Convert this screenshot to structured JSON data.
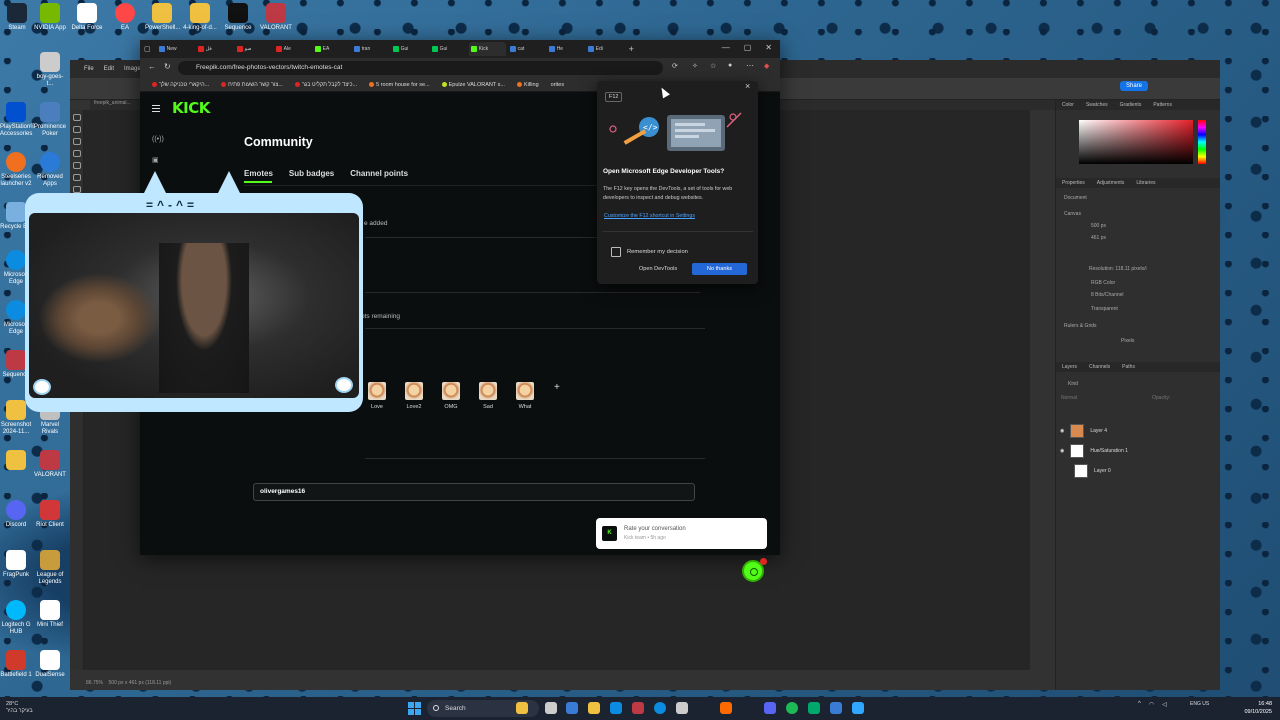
{
  "desktop": {
    "top_icons": [
      {
        "label": "Steam",
        "color": "#1b2838"
      },
      {
        "label": "NVIDIA App",
        "color": "#76b900"
      },
      {
        "label": "Delta Force",
        "color": "#ffffff"
      },
      {
        "label": "EA",
        "color": "#ff4747"
      },
      {
        "label": "PowerShell...",
        "color": "#f0c040"
      },
      {
        "label": "4-king-of-d...",
        "color": "#f0c040"
      },
      {
        "label": "Sequence",
        "color": "#111111"
      },
      {
        "label": "VALORANT",
        "color": "#bd3944"
      }
    ],
    "left_icons": [
      {
        "label": "boy-goes-t...",
        "color": "#cccccc"
      },
      {
        "label": "PlayStation® Accessories",
        "color": "#0050d0"
      },
      {
        "label": "Prominence Poker",
        "color": "#4a7ebc"
      },
      {
        "label": "Steelseries launcher v2",
        "color": "#f07020"
      },
      {
        "label": "Removed Apps",
        "color": "#2a7ad8"
      },
      {
        "label": "Recycle Bin",
        "color": "#7ab0e0"
      },
      {
        "label": "Microsoft Edge",
        "color": "#0c8ce0"
      },
      {
        "label": "Microsoft Edge",
        "color": "#0c8ce0"
      },
      {
        "label": "Sequence",
        "color": "#bd3944"
      },
      {
        "label": "Screenshot 2024-11...",
        "color": "#f0c040"
      },
      {
        "label": "Marvel Rivals",
        "color": "#c0c0c0"
      },
      {
        "label": "",
        "color": "#f0c040"
      },
      {
        "label": "VALORANT",
        "color": "#bd3944"
      },
      {
        "label": "Discord",
        "color": "#5865f2"
      },
      {
        "label": "Riot Client",
        "color": "#d13639"
      },
      {
        "label": "FragPunk",
        "color": "#ffffff"
      },
      {
        "label": "League of Legends",
        "color": "#c89b3c"
      },
      {
        "label": "Logitech G HUB",
        "color": "#00b8fc"
      },
      {
        "label": "Mini Thief",
        "color": "#ffffff"
      },
      {
        "label": "Battlefield 1",
        "color": "#d03a2a"
      },
      {
        "label": "DualSense",
        "color": "#ffffff"
      }
    ]
  },
  "photoshop": {
    "menu": [
      "File",
      "Edit",
      "Image"
    ],
    "share_label": "Share",
    "doc_tab": "freepik_animal...",
    "status_zoom": "86.75%",
    "status_info": "500 px x 461 px (118.11 ppi)",
    "panels": {
      "color_tabs": [
        "Color",
        "Swatches",
        "Gradients",
        "Patterns"
      ],
      "props_tabs": [
        "Properties",
        "Adjustments",
        "Libraries"
      ],
      "document_label": "Document",
      "canvas_label": "Canvas",
      "width": "500 px",
      "height": "461 px",
      "resolution": "Resolution: 118.11 pixels/i",
      "mode": "RGB Color",
      "bits": "8 Bits/Channel",
      "fill": "Transparent",
      "rulers_label": "Rulers & Grids",
      "units": "Pixels",
      "layers_tabs": [
        "Layers",
        "Channels",
        "Paths"
      ],
      "kind_label": "Kind",
      "blend_mode": "Normal",
      "opacity_label": "Opacity:",
      "layers": [
        "Layer 4",
        "Hue/Saturation 1",
        "Layer 0"
      ]
    }
  },
  "browser": {
    "tabs": [
      {
        "label": "New",
        "color": "#3a7bd5",
        "active": false
      },
      {
        "label": "فل",
        "color": "#e02424",
        "active": false
      },
      {
        "label": "صو",
        "color": "#e02424",
        "active": false
      },
      {
        "label": "Ale",
        "color": "#e02424",
        "active": false
      },
      {
        "label": "EA",
        "color": "#53fc18",
        "active": false
      },
      {
        "label": "tran",
        "color": "#3a7bd5",
        "active": false
      },
      {
        "label": "Gui",
        "color": "#00c853",
        "active": false
      },
      {
        "label": "Gui",
        "color": "#00c853",
        "active": false
      },
      {
        "label": "Kick",
        "color": "#53fc18",
        "active": true
      },
      {
        "label": "cat",
        "color": "#3a7bd5",
        "active": false
      },
      {
        "label": "He",
        "color": "#3a7bd5",
        "active": false
      },
      {
        "label": "Edi",
        "color": "#3a7bd5",
        "active": false
      }
    ],
    "url": "Freepik.com/free-photos-vectors/twitch-emotes-cat",
    "bookmarks": [
      {
        "label": "היקארי טכניקה שלך...",
        "color": "#e02424"
      },
      {
        "label": "צור קשר השעות פתיח...",
        "color": "#e02424"
      },
      {
        "label": "כיצד לקבל תקליט בגר...",
        "color": "#e02424"
      },
      {
        "label": "5 room house for se...",
        "color": "#f07020"
      },
      {
        "label": "Epulze VALORANT s...",
        "color": "#c0e020"
      },
      {
        "label": "Killing",
        "color": "#f07020"
      },
      {
        "label": "orites",
        "color": "#cccccc"
      }
    ],
    "kick_logo": "KICK",
    "page_title": "Community",
    "subtabs": [
      "Emotes",
      "Sub badges",
      "Channel points"
    ],
    "info_added": "e added",
    "info_slots": "ots remaining",
    "emotes": [
      {
        "name": "Love"
      },
      {
        "name": "Love2"
      },
      {
        "name": "OMG"
      },
      {
        "name": "Sad"
      },
      {
        "name": "What"
      }
    ],
    "add_emote": "+",
    "username_value": "olivergames16",
    "toast_title": "Rate your conversation",
    "toast_sub": "Kick team • 5h ago"
  },
  "devtools_popup": {
    "key": "F12",
    "close": "×",
    "title": "Open Microsoft Edge Developer Tools?",
    "desc": "The F12 key opens the DevTools, a set of tools for web developers to inspect and debug websites.",
    "link": "Customize the F12 shortcut in Settings",
    "remember": "Remember my decision",
    "open_btn": "Open DevTools",
    "no_btn": "No thanks"
  },
  "webcam": {
    "face": "=^-^="
  },
  "taskbar": {
    "weather_temp": "28°C",
    "weather_text": "בעיקר בהיר",
    "search_label": "Search",
    "apps": [
      "#f0c040",
      "#cccccc",
      "#3a7bd5",
      "#f0c040",
      "#0c8ce0",
      "#0c8ce0",
      "#bd3944",
      "#cccccc",
      "#ff6a00",
      "#5865f2",
      "#1db954",
      "#00a86b",
      "#3a7bd5",
      "#31a8ff"
    ],
    "tray": "^",
    "lang": "ENG US",
    "time": "16:48",
    "date": "09/10/2025"
  }
}
